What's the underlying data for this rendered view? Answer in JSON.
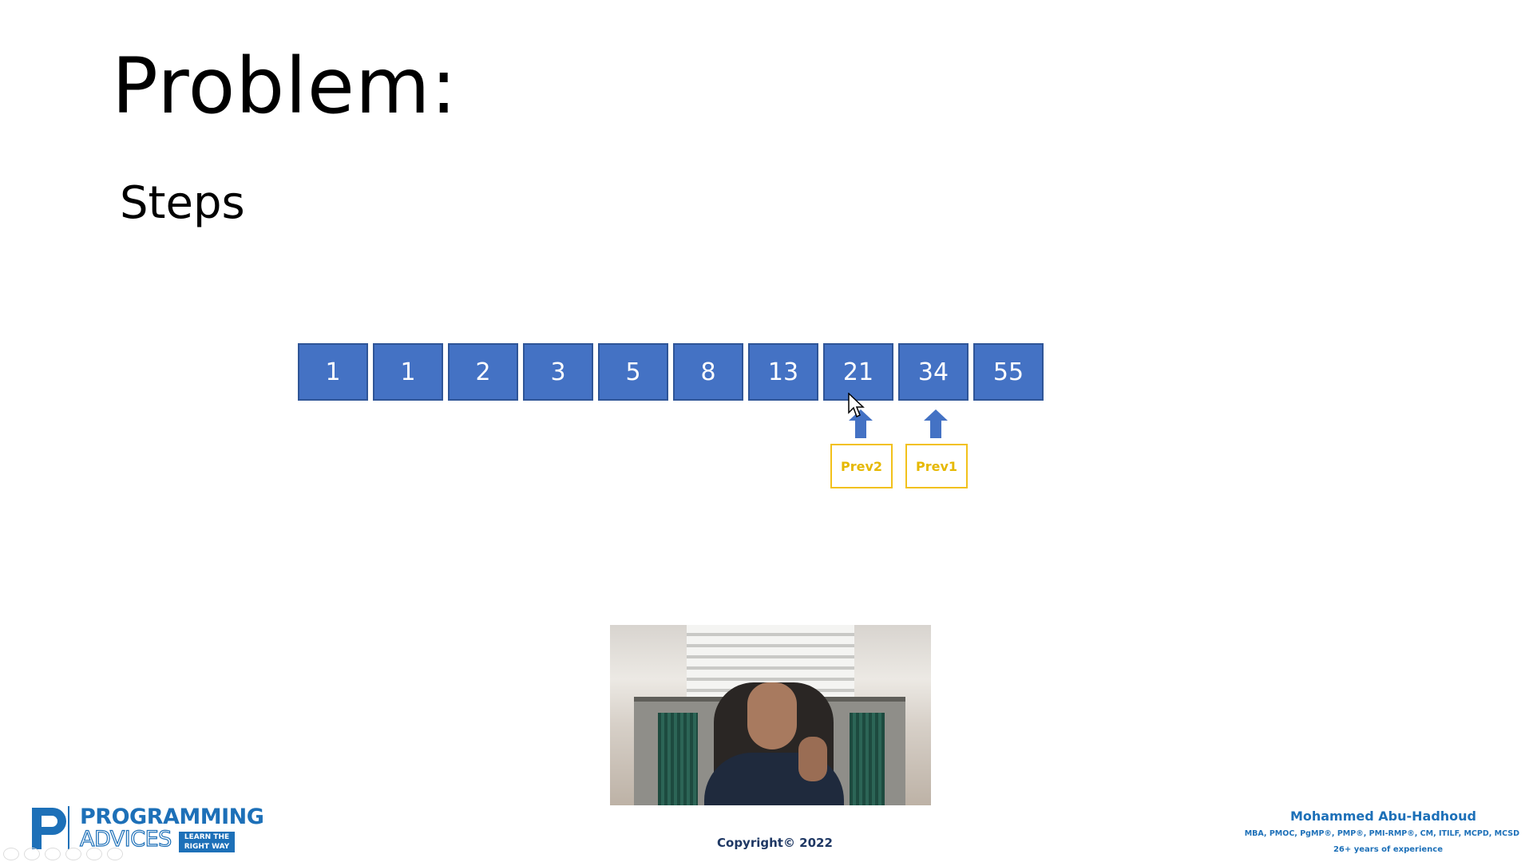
{
  "slide": {
    "title": "Problem:",
    "subtitle": "Steps"
  },
  "sequence": [
    "1",
    "1",
    "2",
    "3",
    "5",
    "8",
    "13",
    "21",
    "34",
    "55"
  ],
  "pointers": [
    {
      "label": "Prev2",
      "points_to_value": "21"
    },
    {
      "label": "Prev1",
      "points_to_value": "34"
    }
  ],
  "footer": {
    "logo_line1": "PROGRAMMING",
    "logo_line2": "ADVICES",
    "logo_tagline": "LEARN THE RIGHT WAY",
    "copyright": "Copyright© 2022",
    "author_name": "Mohammed Abu-Hadhoud",
    "author_credentials": "MBA, PMOC, PgMP®, PMP®, PMI-RMP®, CM, ITILF, MCPD, MCSD",
    "author_experience": "26+ years of experience"
  },
  "colors": {
    "cell_fill": "#4472c4",
    "cell_border": "#2f5597",
    "pointer_label": "#e6b800",
    "brand_blue": "#1d70b8"
  },
  "icons": {
    "cursor": "mouse-pointer-icon",
    "arrows": "up-arrow-icon",
    "slideshow_controls": [
      "prev-icon",
      "next-icon",
      "pen-icon",
      "slides-icon",
      "zoom-icon",
      "more-icon"
    ]
  }
}
